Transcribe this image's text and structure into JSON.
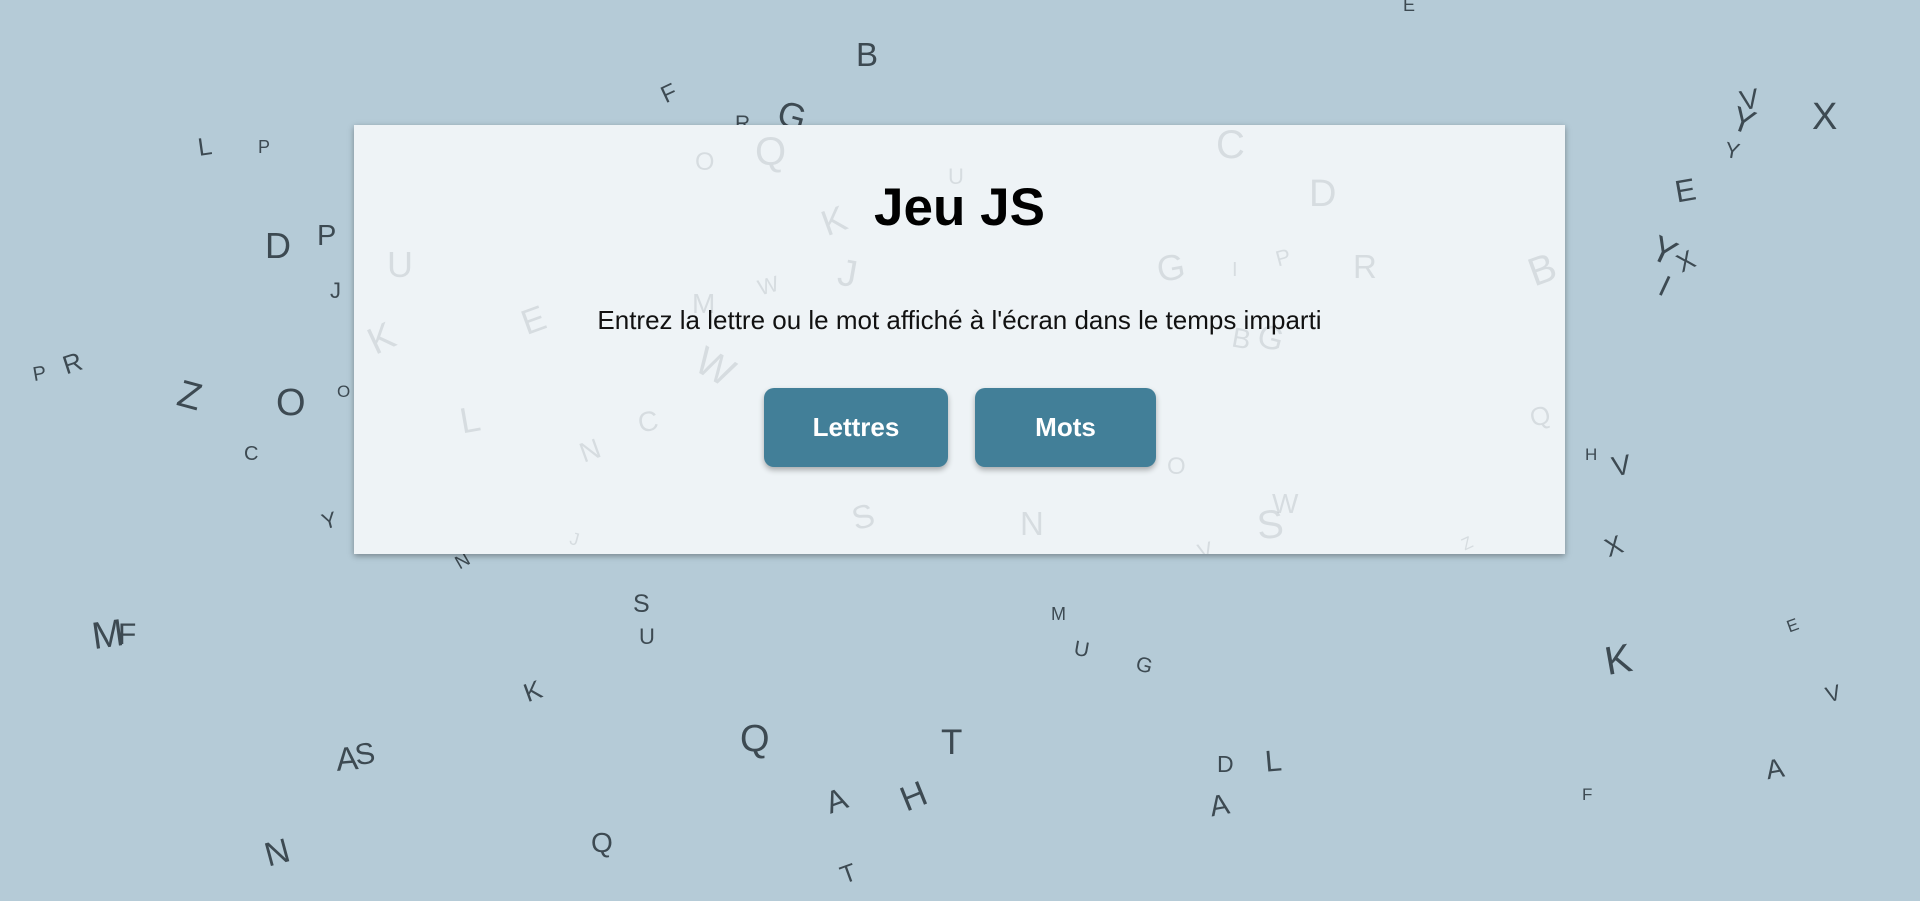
{
  "page": {
    "title": "Jeu JS",
    "subtitle": "Entrez la lettre ou le mot affiché à l'écran dans le temps imparti"
  },
  "buttons": {
    "letters_label": "Lettres",
    "words_label": "Mots"
  },
  "colors": {
    "background": "#b5cbd7",
    "card": "#eef3f6",
    "button": "#427f98",
    "letter": "#3d4a52"
  },
  "background_letters": [
    "B",
    "F",
    "R",
    "G",
    "E",
    "L",
    "P",
    "D",
    "P",
    "J",
    "P",
    "R",
    "Z",
    "O",
    "O",
    "C",
    "Y",
    "N",
    "M",
    "F",
    "S",
    "U",
    "K",
    "A",
    "S",
    "N",
    "Q",
    "Q",
    "A",
    "H",
    "T",
    "T",
    "M",
    "U",
    "G",
    "D",
    "L",
    "A",
    "V",
    "Y",
    "Y",
    "X",
    "E",
    "Y",
    "X",
    "I",
    "H",
    "V",
    "X",
    "K",
    "E",
    "V",
    "A",
    "F"
  ],
  "card_letters": [
    "O",
    "Q",
    "U",
    "C",
    "D",
    "K",
    "J",
    "U",
    "W",
    "M",
    "E",
    "K",
    "G",
    "I",
    "P",
    "R",
    "B",
    "B",
    "G",
    "W",
    "N",
    "C",
    "L",
    "Q",
    "O",
    "S",
    "N",
    "W",
    "S",
    "J",
    "V",
    "Z"
  ]
}
